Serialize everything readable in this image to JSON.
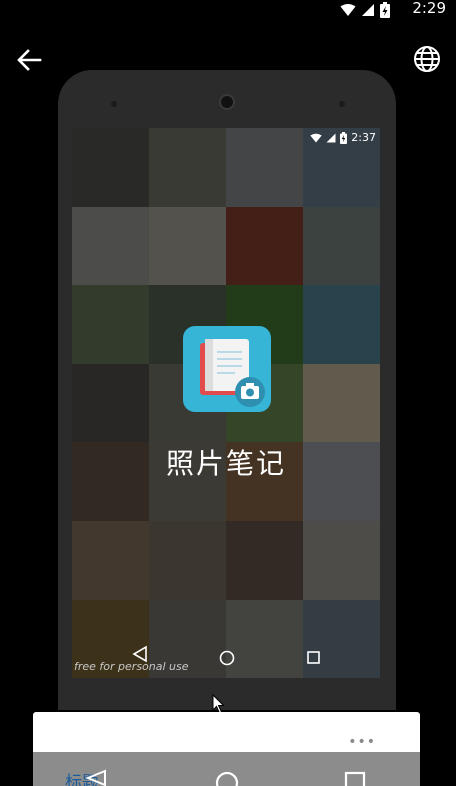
{
  "status_bar": {
    "time": "2:29",
    "icons": [
      "wifi-icon",
      "cell-signal-icon",
      "battery-charging-icon"
    ]
  },
  "top_bar": {
    "back_icon": "arrow-back-icon",
    "globe_icon": "globe-icon"
  },
  "preview": {
    "status_time": "2:37",
    "app_name": "照片笔记",
    "app_icon": "notebook-camera-icon",
    "watermark": "free for personal use",
    "nav_icons": [
      "nav-back-icon",
      "nav-home-icon",
      "nav-recents-icon"
    ]
  },
  "sheet": {
    "more_label": "•••"
  },
  "bottom_nav": {
    "label": "标题"
  },
  "colors": {
    "app_icon_bg": "#36b5d6",
    "phone_frame": "#2b2b2b",
    "label_blue": "#1c5b9a"
  }
}
